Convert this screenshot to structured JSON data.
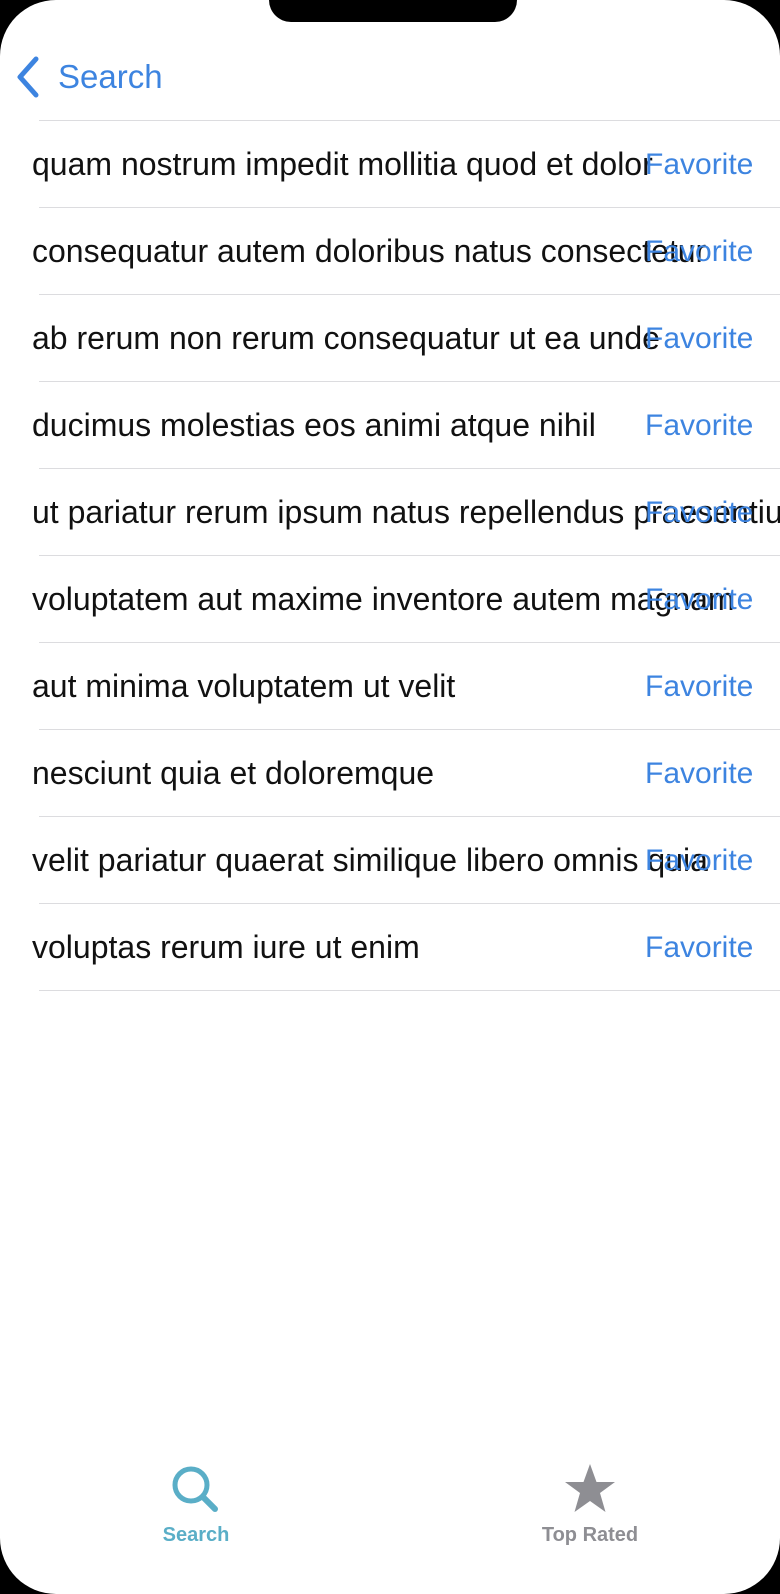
{
  "nav": {
    "back_label": "Search"
  },
  "rows": [
    {
      "title": "quam nostrum impedit mollitia quod et dolor",
      "action": "Favorite"
    },
    {
      "title": "consequatur autem doloribus natus consectetur",
      "action": "Favorite"
    },
    {
      "title": "ab rerum non rerum consequatur ut ea unde",
      "action": "Favorite"
    },
    {
      "title": "ducimus molestias eos animi atque nihil",
      "action": "Favorite"
    },
    {
      "title": "ut pariatur rerum ipsum natus repellendus praesentium",
      "action": "Favorite"
    },
    {
      "title": "voluptatem aut maxime inventore autem magnam",
      "action": "Favorite"
    },
    {
      "title": "aut minima voluptatem ut velit",
      "action": "Favorite"
    },
    {
      "title": "nesciunt quia et doloremque",
      "action": "Favorite"
    },
    {
      "title": "velit pariatur quaerat similique libero omnis quia",
      "action": "Favorite"
    },
    {
      "title": "voluptas rerum iure ut enim",
      "action": "Favorite"
    }
  ],
  "tabbar": {
    "tabs": [
      {
        "label": "Search",
        "icon": "magnifying-glass-icon",
        "selected": true
      },
      {
        "label": "Top Rated",
        "icon": "star-icon",
        "selected": false
      }
    ]
  },
  "colors": {
    "accent_link": "#3d84e0",
    "tab_selected": "#5aaec7",
    "tab_unselected": "#8e8e93",
    "separator": "#dcdcdf",
    "text": "#111111",
    "background": "#ffffff"
  }
}
